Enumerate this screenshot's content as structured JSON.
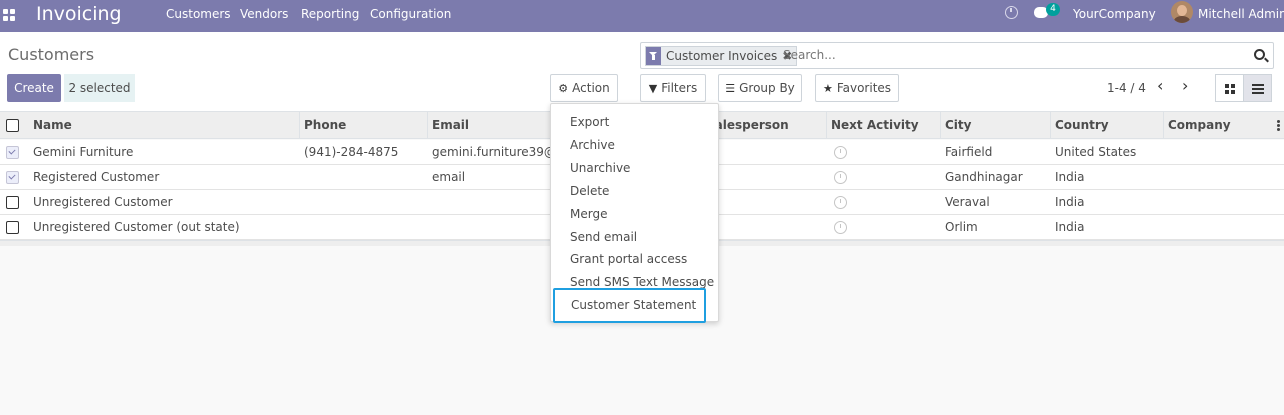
{
  "navbar": {
    "app_title": "Invoicing",
    "menu": [
      "Customers",
      "Vendors",
      "Reporting",
      "Configuration"
    ],
    "message_count": "4",
    "company": "YourCompany",
    "user": "Mitchell Admin",
    "color": "#7c7bad"
  },
  "control": {
    "title": "Customers",
    "create_label": "Create",
    "selected_label": "2 selected",
    "action_label": "Action",
    "filters_label": "Filters",
    "groupby_label": "Group By",
    "favorites_label": "Favorites",
    "pager": "1-4 / 4",
    "search": {
      "facet": "Customer Invoices",
      "placeholder": "Search..."
    }
  },
  "table": {
    "columns": [
      "Name",
      "Phone",
      "Email",
      "Salesperson",
      "Next Activity",
      "City",
      "Country",
      "Company"
    ],
    "rows": [
      {
        "selected": true,
        "name": "Gemini Furniture",
        "phone": "(941)-284-4875",
        "email": "gemini.furniture39@ex",
        "city": "Fairfield",
        "country": "United States"
      },
      {
        "selected": true,
        "name": "Registered Customer",
        "phone": "",
        "email": "email",
        "city": "Gandhinagar",
        "country": "India"
      },
      {
        "selected": false,
        "name": "Unregistered Customer",
        "phone": "",
        "email": "",
        "city": "Veraval",
        "country": "India"
      },
      {
        "selected": false,
        "name": "Unregistered Customer (out state)",
        "phone": "",
        "email": "",
        "city": "Orlim",
        "country": "India"
      }
    ]
  },
  "action_menu": {
    "items": [
      "Export",
      "Archive",
      "Unarchive",
      "Delete",
      "Merge",
      "Send email",
      "Grant portal access",
      "Send SMS Text Message",
      "Customer Statement"
    ],
    "highlight_color": "#1f9fe0"
  }
}
